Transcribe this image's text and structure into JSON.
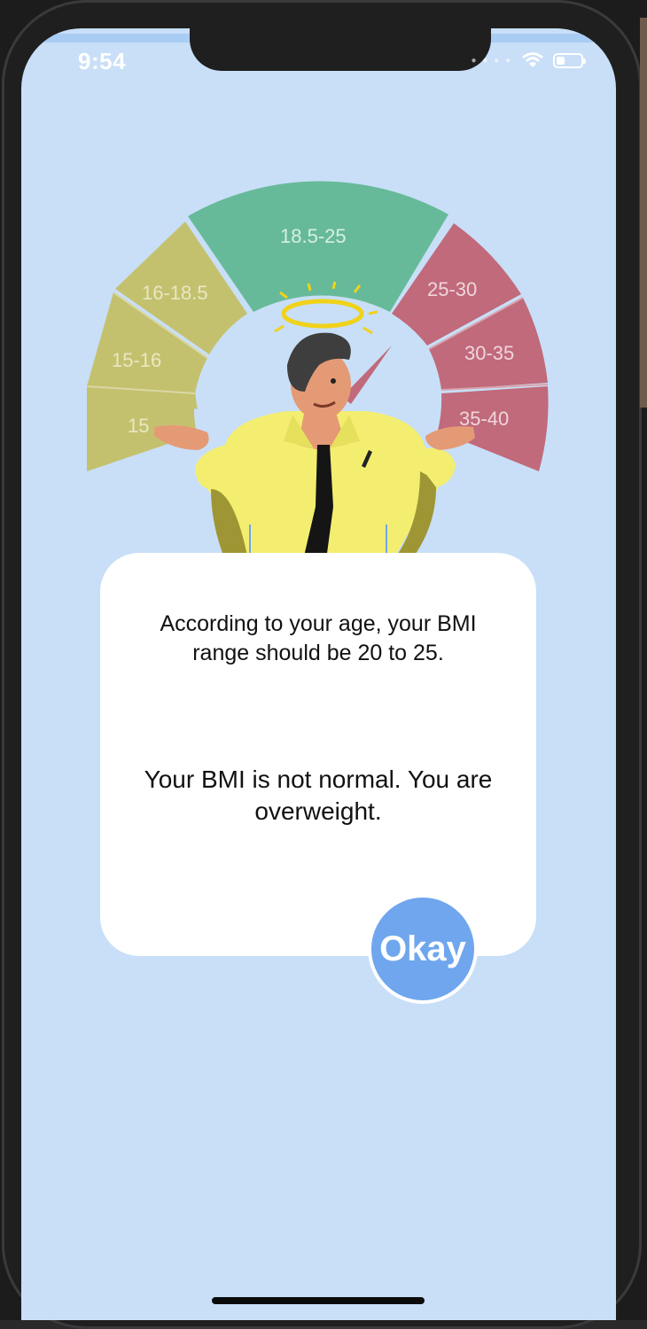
{
  "status_bar": {
    "time": "9:54",
    "battery_level": 0.35
  },
  "gauge": {
    "ranges": [
      "15",
      "15-16",
      "16-18.5",
      "18.5-25",
      "25-30",
      "30-35",
      "35-40"
    ],
    "colors": {
      "underweight": "#c4c16e",
      "normal": "#67ba99",
      "overweight": "#c06a7b"
    }
  },
  "dialog": {
    "age_message": "According to your age, your BMI range should be 20 to 25.",
    "result_message": "Your BMI is not normal. You are overweight.",
    "okay_label": "Okay"
  },
  "colors": {
    "background": "#c8dff7",
    "button": "#6fa6ee"
  }
}
